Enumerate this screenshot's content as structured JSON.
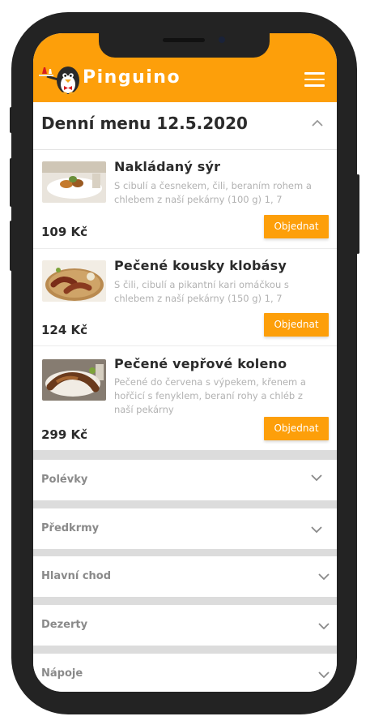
{
  "app": {
    "brand": "Pinguino"
  },
  "icons": {
    "logo": "penguin-waiter-logo",
    "menu": "hamburger-icon",
    "collapse": "chevron-up-icon",
    "expand": "chevron-down-icon"
  },
  "colors": {
    "accent": "#fd9f0a",
    "text": "#2b2b2b",
    "muted": "#b2b2b2",
    "category_text": "#8a8a8a",
    "separator": "#dcdcdc"
  },
  "daily_menu": {
    "title": "Denní menu 12.5.2020",
    "items": [
      {
        "name": "Nakládaný sýr",
        "description": "S cibulí a česnekem, čili, beraním rohem a chlebem z naší pekárny (100 g) 1, 7",
        "price": "109 Kč",
        "order_label": "Objednat"
      },
      {
        "name": "Pečené kousky klobásy",
        "description": "S čili, cibulí a pikantní kari omáčkou s chlebem z naší pekárny (150 g) 1, 7",
        "price": "124 Kč",
        "order_label": "Objednat"
      },
      {
        "name": "Pečené vepřové koleno",
        "description": "Pečené do červena s výpekem, křenem a hořčicí s fenyklem, beraní rohy a chléb z naší pekárny",
        "price": "299 Kč",
        "order_label": "Objednat"
      }
    ]
  },
  "categories": [
    {
      "label": "Polévky"
    },
    {
      "label": "Předkrmy"
    },
    {
      "label": "Hlavní chod"
    },
    {
      "label": "Dezerty"
    },
    {
      "label": "Nápoje"
    }
  ]
}
